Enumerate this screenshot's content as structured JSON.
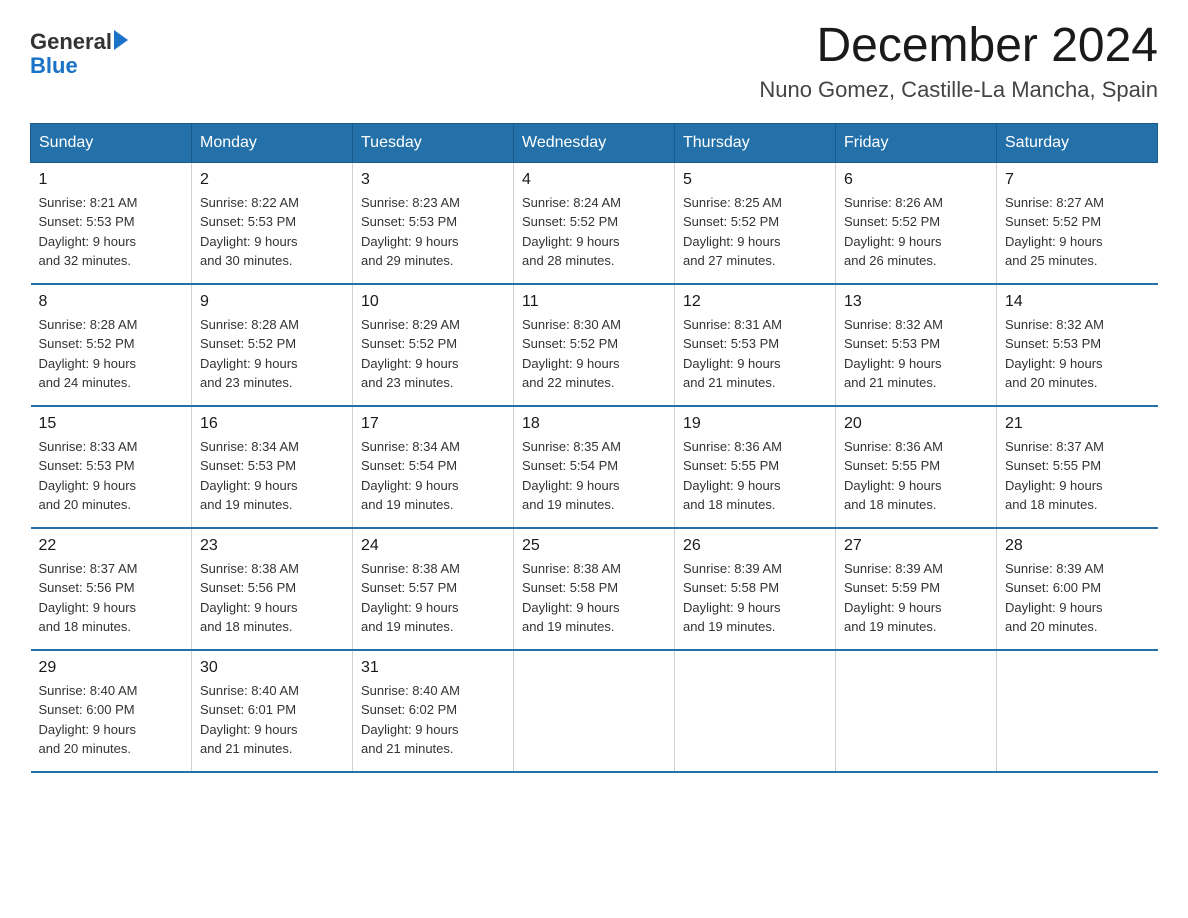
{
  "logo": {
    "text_general": "General",
    "text_blue": "Blue",
    "arrow": "▶"
  },
  "title": {
    "month": "December 2024",
    "location": "Nuno Gomez, Castille-La Mancha, Spain"
  },
  "header_days": [
    "Sunday",
    "Monday",
    "Tuesday",
    "Wednesday",
    "Thursday",
    "Friday",
    "Saturday"
  ],
  "weeks": [
    [
      {
        "day": "1",
        "sunrise": "8:21 AM",
        "sunset": "5:53 PM",
        "daylight": "9 hours and 32 minutes."
      },
      {
        "day": "2",
        "sunrise": "8:22 AM",
        "sunset": "5:53 PM",
        "daylight": "9 hours and 30 minutes."
      },
      {
        "day": "3",
        "sunrise": "8:23 AM",
        "sunset": "5:53 PM",
        "daylight": "9 hours and 29 minutes."
      },
      {
        "day": "4",
        "sunrise": "8:24 AM",
        "sunset": "5:52 PM",
        "daylight": "9 hours and 28 minutes."
      },
      {
        "day": "5",
        "sunrise": "8:25 AM",
        "sunset": "5:52 PM",
        "daylight": "9 hours and 27 minutes."
      },
      {
        "day": "6",
        "sunrise": "8:26 AM",
        "sunset": "5:52 PM",
        "daylight": "9 hours and 26 minutes."
      },
      {
        "day": "7",
        "sunrise": "8:27 AM",
        "sunset": "5:52 PM",
        "daylight": "9 hours and 25 minutes."
      }
    ],
    [
      {
        "day": "8",
        "sunrise": "8:28 AM",
        "sunset": "5:52 PM",
        "daylight": "9 hours and 24 minutes."
      },
      {
        "day": "9",
        "sunrise": "8:28 AM",
        "sunset": "5:52 PM",
        "daylight": "9 hours and 23 minutes."
      },
      {
        "day": "10",
        "sunrise": "8:29 AM",
        "sunset": "5:52 PM",
        "daylight": "9 hours and 23 minutes."
      },
      {
        "day": "11",
        "sunrise": "8:30 AM",
        "sunset": "5:52 PM",
        "daylight": "9 hours and 22 minutes."
      },
      {
        "day": "12",
        "sunrise": "8:31 AM",
        "sunset": "5:53 PM",
        "daylight": "9 hours and 21 minutes."
      },
      {
        "day": "13",
        "sunrise": "8:32 AM",
        "sunset": "5:53 PM",
        "daylight": "9 hours and 21 minutes."
      },
      {
        "day": "14",
        "sunrise": "8:32 AM",
        "sunset": "5:53 PM",
        "daylight": "9 hours and 20 minutes."
      }
    ],
    [
      {
        "day": "15",
        "sunrise": "8:33 AM",
        "sunset": "5:53 PM",
        "daylight": "9 hours and 20 minutes."
      },
      {
        "day": "16",
        "sunrise": "8:34 AM",
        "sunset": "5:53 PM",
        "daylight": "9 hours and 19 minutes."
      },
      {
        "day": "17",
        "sunrise": "8:34 AM",
        "sunset": "5:54 PM",
        "daylight": "9 hours and 19 minutes."
      },
      {
        "day": "18",
        "sunrise": "8:35 AM",
        "sunset": "5:54 PM",
        "daylight": "9 hours and 19 minutes."
      },
      {
        "day": "19",
        "sunrise": "8:36 AM",
        "sunset": "5:55 PM",
        "daylight": "9 hours and 18 minutes."
      },
      {
        "day": "20",
        "sunrise": "8:36 AM",
        "sunset": "5:55 PM",
        "daylight": "9 hours and 18 minutes."
      },
      {
        "day": "21",
        "sunrise": "8:37 AM",
        "sunset": "5:55 PM",
        "daylight": "9 hours and 18 minutes."
      }
    ],
    [
      {
        "day": "22",
        "sunrise": "8:37 AM",
        "sunset": "5:56 PM",
        "daylight": "9 hours and 18 minutes."
      },
      {
        "day": "23",
        "sunrise": "8:38 AM",
        "sunset": "5:56 PM",
        "daylight": "9 hours and 18 minutes."
      },
      {
        "day": "24",
        "sunrise": "8:38 AM",
        "sunset": "5:57 PM",
        "daylight": "9 hours and 19 minutes."
      },
      {
        "day": "25",
        "sunrise": "8:38 AM",
        "sunset": "5:58 PM",
        "daylight": "9 hours and 19 minutes."
      },
      {
        "day": "26",
        "sunrise": "8:39 AM",
        "sunset": "5:58 PM",
        "daylight": "9 hours and 19 minutes."
      },
      {
        "day": "27",
        "sunrise": "8:39 AM",
        "sunset": "5:59 PM",
        "daylight": "9 hours and 19 minutes."
      },
      {
        "day": "28",
        "sunrise": "8:39 AM",
        "sunset": "6:00 PM",
        "daylight": "9 hours and 20 minutes."
      }
    ],
    [
      {
        "day": "29",
        "sunrise": "8:40 AM",
        "sunset": "6:00 PM",
        "daylight": "9 hours and 20 minutes."
      },
      {
        "day": "30",
        "sunrise": "8:40 AM",
        "sunset": "6:01 PM",
        "daylight": "9 hours and 21 minutes."
      },
      {
        "day": "31",
        "sunrise": "8:40 AM",
        "sunset": "6:02 PM",
        "daylight": "9 hours and 21 minutes."
      },
      null,
      null,
      null,
      null
    ]
  ],
  "labels": {
    "sunrise": "Sunrise:",
    "sunset": "Sunset:",
    "daylight": "Daylight:"
  }
}
